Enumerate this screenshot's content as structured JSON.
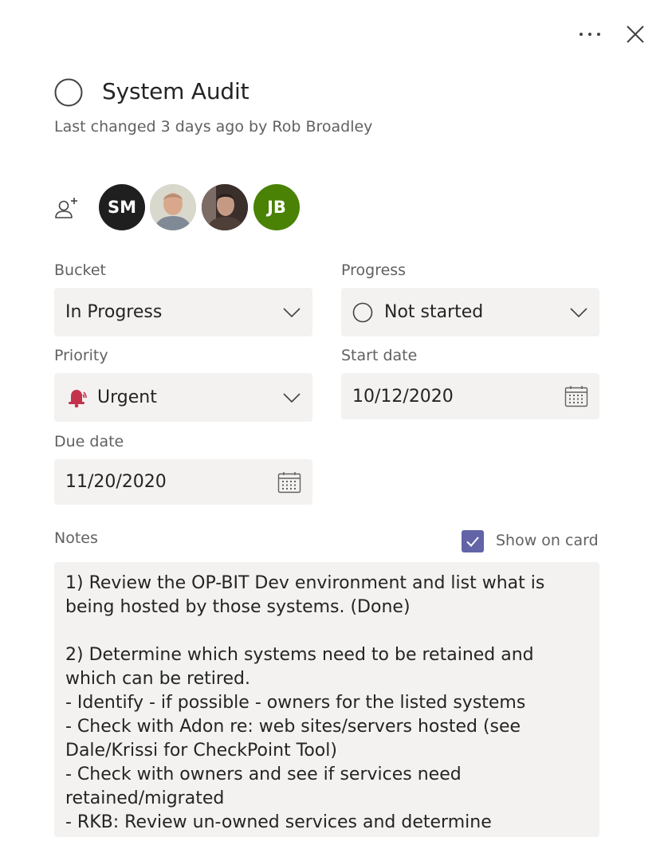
{
  "header": {
    "more_icon": "more-horizontal-icon",
    "close_icon": "close-icon"
  },
  "task": {
    "title": "System Audit",
    "last_changed": "Last changed 3 days ago by Rob Broadley",
    "complete_icon": "circle-icon"
  },
  "assignees": {
    "assign_icon": "person-add-icon",
    "people": [
      {
        "initials": "SM",
        "color": "#1f1f1f"
      },
      {
        "initials": "",
        "type": "photo"
      },
      {
        "initials": "",
        "type": "photo"
      },
      {
        "initials": "JB",
        "color": "#498205"
      }
    ]
  },
  "fields": {
    "bucket": {
      "label": "Bucket",
      "value": "In Progress"
    },
    "progress": {
      "label": "Progress",
      "value": "Not started",
      "icon": "circle-icon"
    },
    "priority": {
      "label": "Priority",
      "value": "Urgent",
      "icon": "urgent-bell-icon",
      "icon_color": "#c4314b"
    },
    "start_date": {
      "label": "Start date",
      "value": "10/12/2020"
    },
    "due_date": {
      "label": "Due date",
      "value": "11/20/2020"
    }
  },
  "notes": {
    "label": "Notes",
    "show_on_card_label": "Show on card",
    "show_on_card_checked": true,
    "text": "1) Review the OP-BIT Dev environment and list what is being hosted by those systems. (Done)\n\n2) Determine which systems need to be retained and which can be retired.\n- Identify - if possible - owners for the listed systems\n- Check with Adon re: web sites/servers hosted (see Dale/Krissi for CheckPoint Tool)\n- Check with owners and see if services need retained/migrated\n- RKB: Review un-owned services and determine"
  },
  "colors": {
    "accent": "#6264a7",
    "field_bg": "#f3f2f1",
    "label_text": "#616161",
    "urgent": "#c4314b"
  }
}
